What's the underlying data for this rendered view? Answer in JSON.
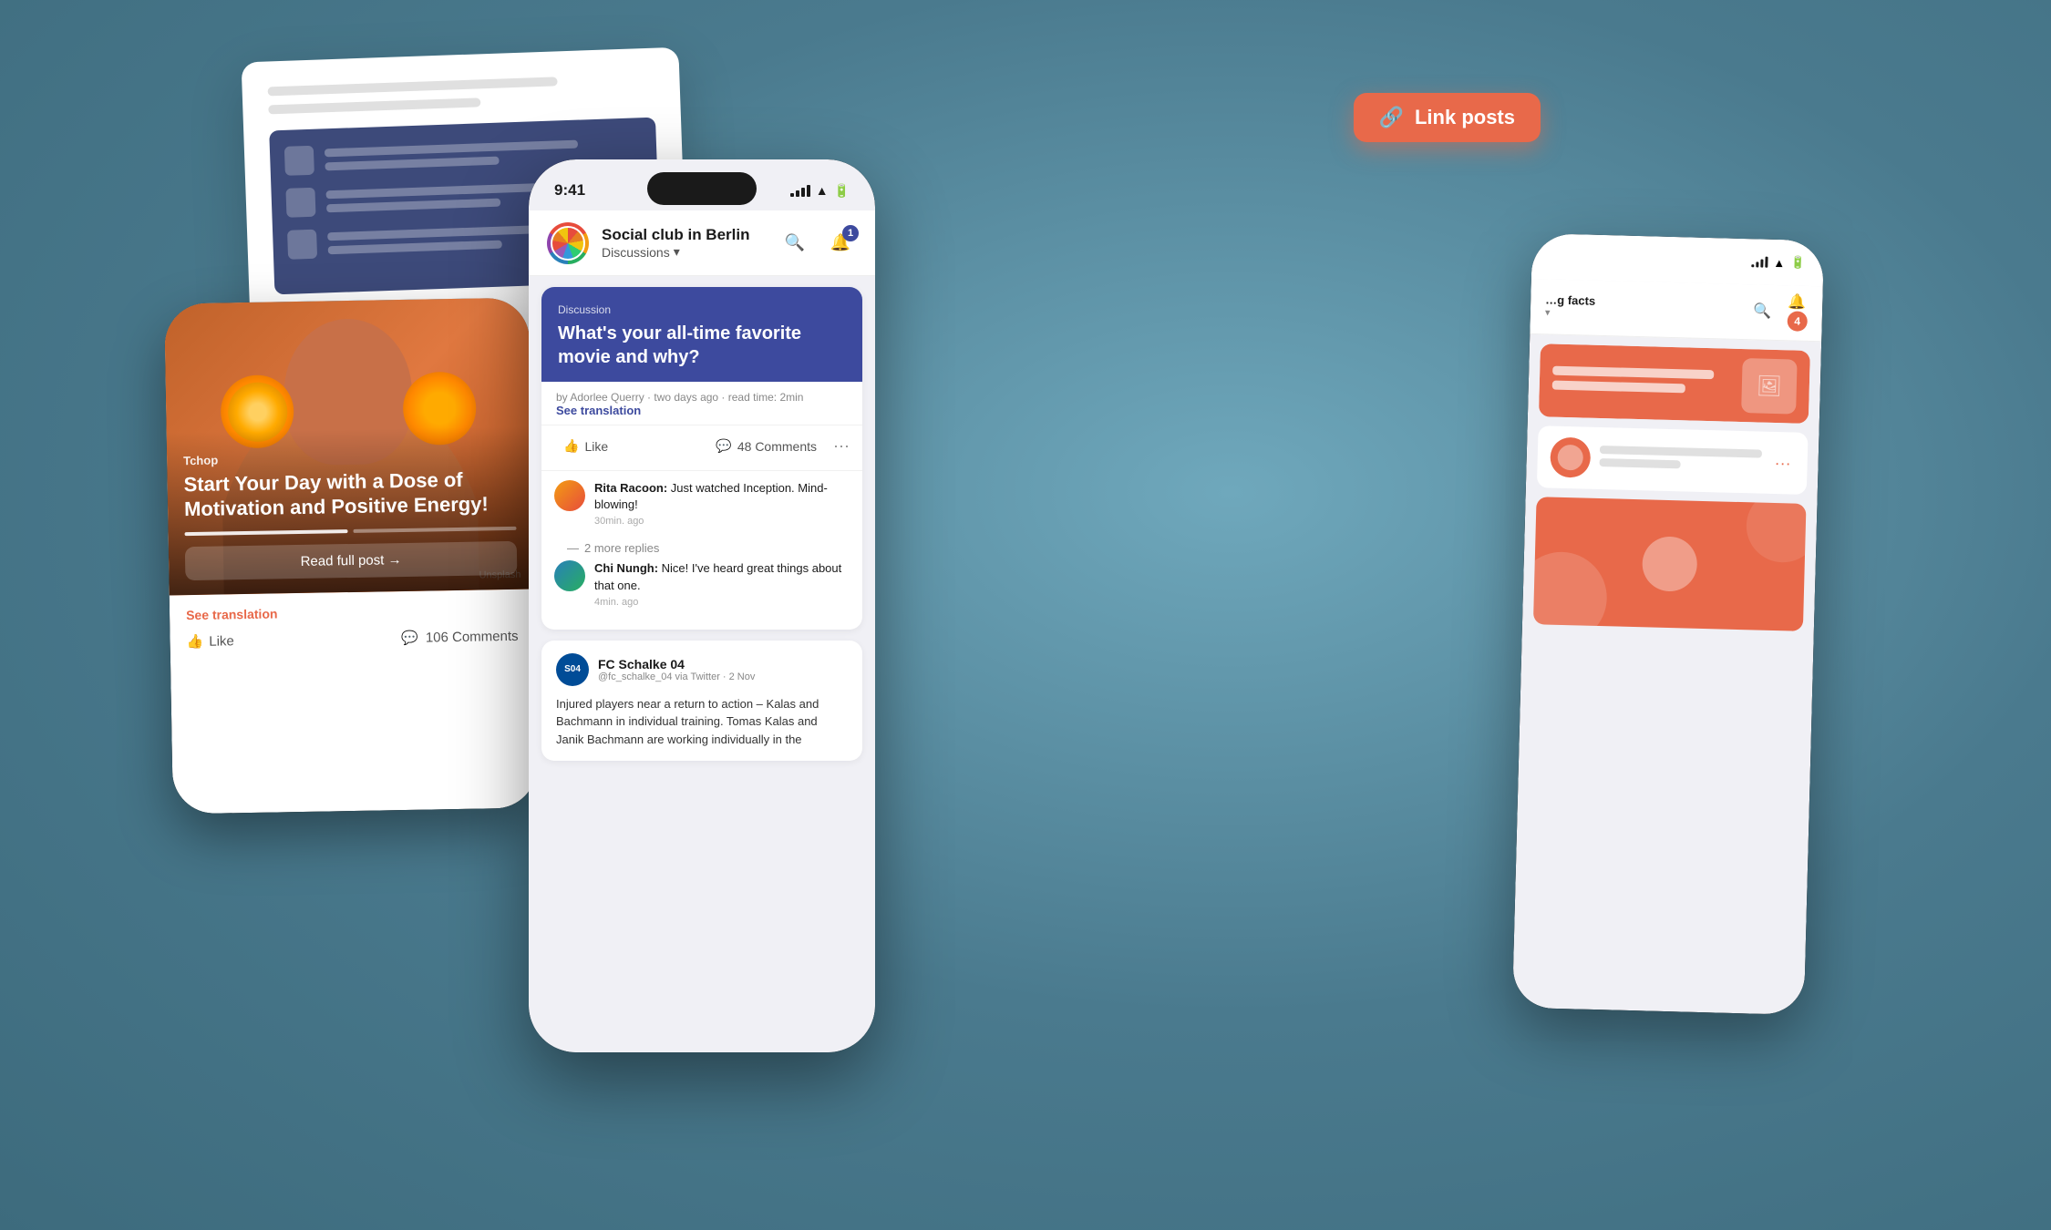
{
  "status_bar": {
    "time": "9:41",
    "signal": "signal",
    "wifi": "wifi",
    "battery": "battery"
  },
  "group": {
    "name": "Social club in Berlin",
    "sub": "Discussions",
    "chevron": "▾"
  },
  "header_buttons": {
    "search_label": "search",
    "notifications_label": "notifications",
    "notification_count": "1"
  },
  "discussion_post": {
    "tag": "Discussion",
    "title": "What's your all-time favorite movie\nand why?",
    "meta": "by Adorlee Querry · two days ago · read time: 2min",
    "see_translation": "See translation",
    "like_label": "Like",
    "comments_count": "48 Comments",
    "more_label": "···"
  },
  "comments": [
    {
      "author": "Rita Racoon",
      "text": "Just watched Inception. Mind-blowing!",
      "time": "30min. ago"
    },
    {
      "author": "Chi Nungh",
      "text": "Nice! I've heard great things about that one.",
      "time": "4min. ago"
    }
  ],
  "more_replies": "2 more replies",
  "schalke_post": {
    "name": "FC Schalke 04",
    "meta": "@fc_schalke_04 via Twitter · 2 Nov",
    "text": "Injured players near a return to action – Kalas and Bachmann in individual training. Tomas Kalas and Janik Bachmann are working individually in the"
  },
  "article_card": {
    "category": "Tchop",
    "title": "Start Your Day with a Dose of Motivation and Positive Energy!",
    "read_full": "Read full post →",
    "see_translation": "See translation",
    "like_label": "Like",
    "comments_count": "106 Comments"
  },
  "link_posts_badge": {
    "label": "Link posts",
    "icon": "🔗"
  },
  "right_phone": {
    "status_bar": {
      "wifi": "wifi",
      "battery": "battery",
      "signal": "signal"
    },
    "notifications_badge": "4"
  }
}
